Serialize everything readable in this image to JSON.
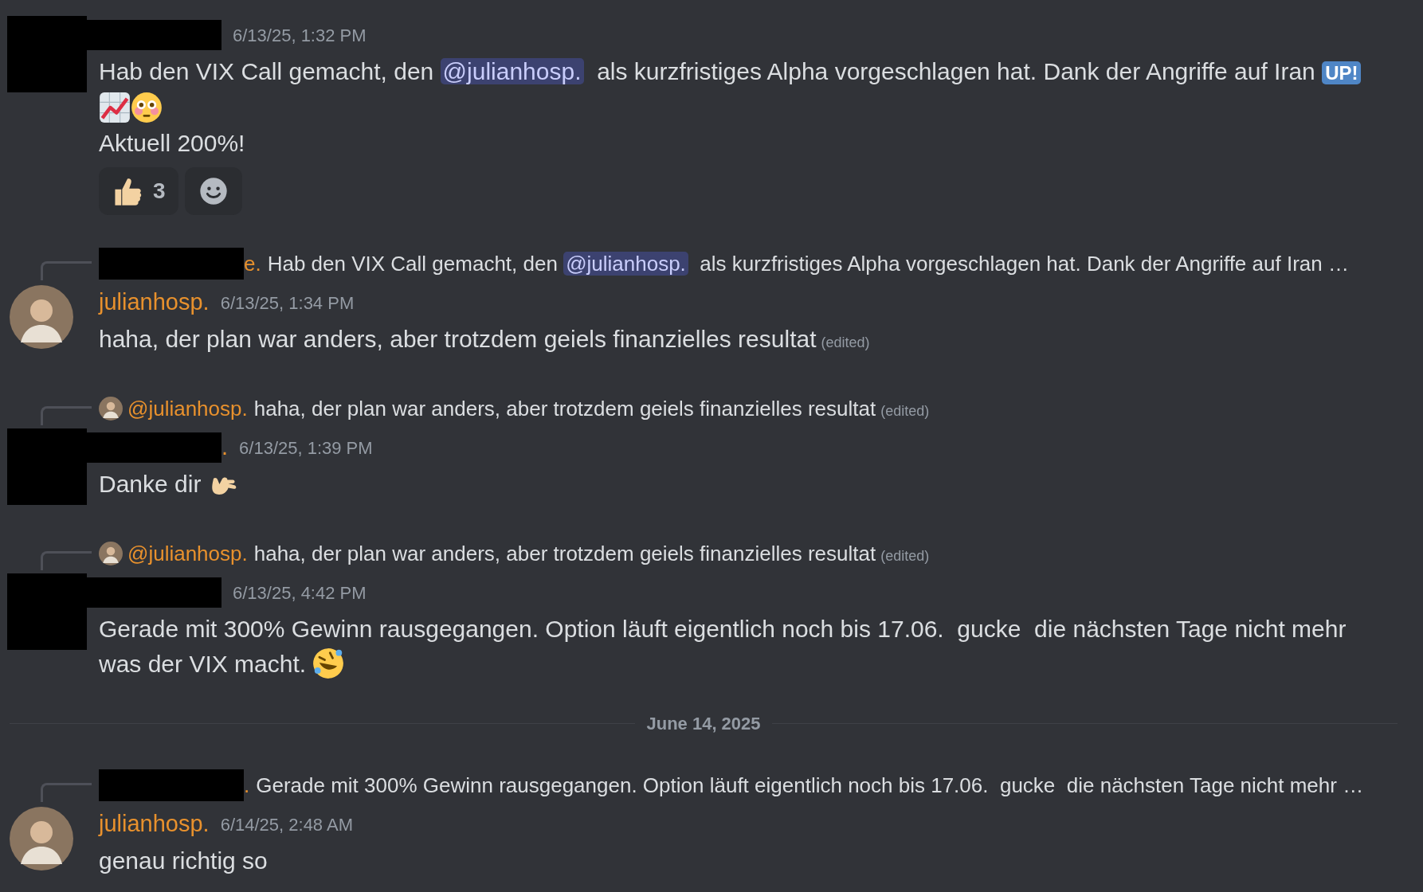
{
  "messages": [
    {
      "kind": "message",
      "author": {
        "redacted": true
      },
      "timestamp": "6/13/25, 1:32 PM",
      "lines": [
        [
          {
            "kind": "text",
            "text": "Hab den VIX Call gemacht, den "
          },
          {
            "kind": "mention",
            "text": "@julianhosp."
          },
          {
            "kind": "text",
            "text": "  als kurzfristiges Alpha vorgeschlagen hat. Dank der Angriffe auf Iran "
          },
          {
            "kind": "badge",
            "text": "UP!"
          }
        ],
        [
          {
            "kind": "chart-emoji"
          },
          {
            "kind": "flushed-emoji"
          }
        ],
        [
          {
            "kind": "text",
            "text": "Aktuell 200%!"
          }
        ]
      ],
      "reactions": [
        {
          "kind": "thumbs",
          "count": "3"
        },
        {
          "kind": "add"
        }
      ]
    },
    {
      "kind": "message",
      "reply": {
        "author": {
          "redacted": true,
          "tail": "e."
        },
        "parts": [
          {
            "kind": "text",
            "text": "Hab den VIX Call gemacht, den "
          },
          {
            "kind": "mention",
            "text": "@julianhosp."
          },
          {
            "kind": "text",
            "text": "  als kurzfristiges Alpha vorgeschlagen hat. Dank der Angriffe auf Iran …"
          }
        ]
      },
      "author": {
        "redacted": false,
        "name": "julianhosp."
      },
      "timestamp": "6/13/25, 1:34 PM",
      "lines": [
        [
          {
            "kind": "text",
            "text": "haha, der plan war anders, aber trotzdem geiels finanzielles resultat"
          },
          {
            "kind": "edited",
            "text": "(edited)"
          }
        ]
      ]
    },
    {
      "kind": "message",
      "reply": {
        "author": {
          "redacted": false,
          "name": "@julianhosp."
        },
        "parts": [
          {
            "kind": "text",
            "text": "haha, der plan war anders, aber trotzdem geiels finanzielles resultat"
          },
          {
            "kind": "edited",
            "text": "(edited)"
          }
        ]
      },
      "author": {
        "redacted": true,
        "tail": "."
      },
      "timestamp": "6/13/25, 1:39 PM",
      "lines": [
        [
          {
            "kind": "text",
            "text": "Danke dir "
          },
          {
            "kind": "callme-emoji"
          }
        ]
      ]
    },
    {
      "kind": "message",
      "reply": {
        "author": {
          "redacted": false,
          "name": "@julianhosp."
        },
        "parts": [
          {
            "kind": "text",
            "text": "haha, der plan war anders, aber trotzdem geiels finanzielles resultat"
          },
          {
            "kind": "edited",
            "text": "(edited)"
          }
        ]
      },
      "author": {
        "redacted": true
      },
      "timestamp": "6/13/25, 4:42 PM",
      "lines": [
        [
          {
            "kind": "text",
            "text": "Gerade mit 300% Gewinn rausgegangen. Option läuft eigentlich noch bis 17.06.  gucke  die nächsten Tage nicht mehr"
          }
        ],
        [
          {
            "kind": "text",
            "text": "was der VIX macht. "
          },
          {
            "kind": "rofl-emoji"
          }
        ]
      ]
    },
    {
      "kind": "divider",
      "label": "June 14, 2025"
    },
    {
      "kind": "message",
      "reply": {
        "author": {
          "redacted": true,
          "tail": "."
        },
        "parts": [
          {
            "kind": "text",
            "text": "Gerade mit 300% Gewinn rausgegangen. Option läuft eigentlich noch bis 17.06.  gucke  die nächsten Tage nicht mehr …"
          }
        ]
      },
      "author": {
        "redacted": false,
        "name": "julianhosp."
      },
      "timestamp": "6/14/25, 2:48 AM",
      "lines": [
        [
          {
            "kind": "text",
            "text": "genau richtig so"
          }
        ]
      ]
    }
  ]
}
